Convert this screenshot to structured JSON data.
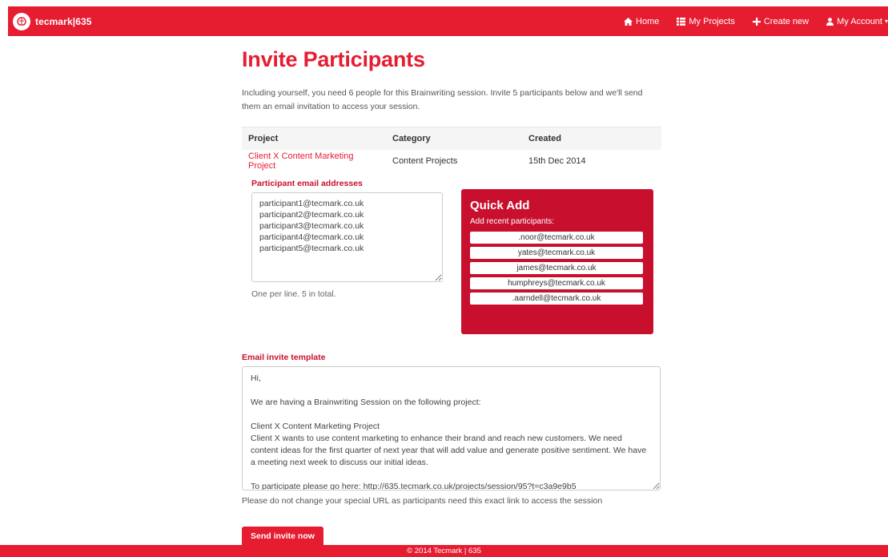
{
  "colors": {
    "brand": "#e61c31",
    "panel": "#c8102e"
  },
  "navbar": {
    "brand": "tecmark|635",
    "links": [
      {
        "label": "Home",
        "icon": "home-icon"
      },
      {
        "label": "My Projects",
        "icon": "list-icon"
      },
      {
        "label": "Create new",
        "icon": "plus-icon"
      },
      {
        "label": "My Account",
        "icon": "user-icon"
      }
    ]
  },
  "main": {
    "title": "Invite Participants",
    "intro": "Including yourself, you need 6 people for this Brainwriting session. Invite 5 participants below and we'll send them an email invitation to access your session.",
    "table": {
      "headers": [
        "Project",
        "Category",
        "Created"
      ],
      "row": [
        "Client X Content Marketing Project",
        "Content Projects",
        "15th Dec 2014"
      ]
    },
    "emails": {
      "label": "Participant email addresses",
      "value": "participant1@tecmark.co.uk\nparticipant2@tecmark.co.uk\nparticipant3@tecmark.co.uk\nparticipant4@tecmark.co.uk\nparticipant5@tecmark.co.uk",
      "help": "One per line. 5 in total."
    },
    "quick_add": {
      "title": "Quick Add",
      "subtitle": "Add recent participants:",
      "items": [
        ".noor@tecmark.co.uk",
        "yates@tecmark.co.uk",
        "james@tecmark.co.uk",
        "humphreys@tecmark.co.uk",
        ".aarndell@tecmark.co.uk"
      ]
    },
    "template": {
      "label": "Email invite template",
      "value": "Hi,\n\nWe are having a Brainwriting Session on the following project:\n\nClient X Content Marketing Project\nClient X wants to use content marketing to enhance their brand and reach new customers. We need content ideas for the first quarter of next year that will add value and generate positive sentiment. We have a meeting next week to discuss our initial ideas.\n\nTo participate please go here: http://635.tecmark.co.uk/projects/session/95?t=c3a9e9b5",
      "help": "Please do not change your special URL as participants need this exact link to access the session"
    },
    "send_label": "Send invite now"
  },
  "footer": {
    "text": "© 2014 Tecmark | 635"
  }
}
